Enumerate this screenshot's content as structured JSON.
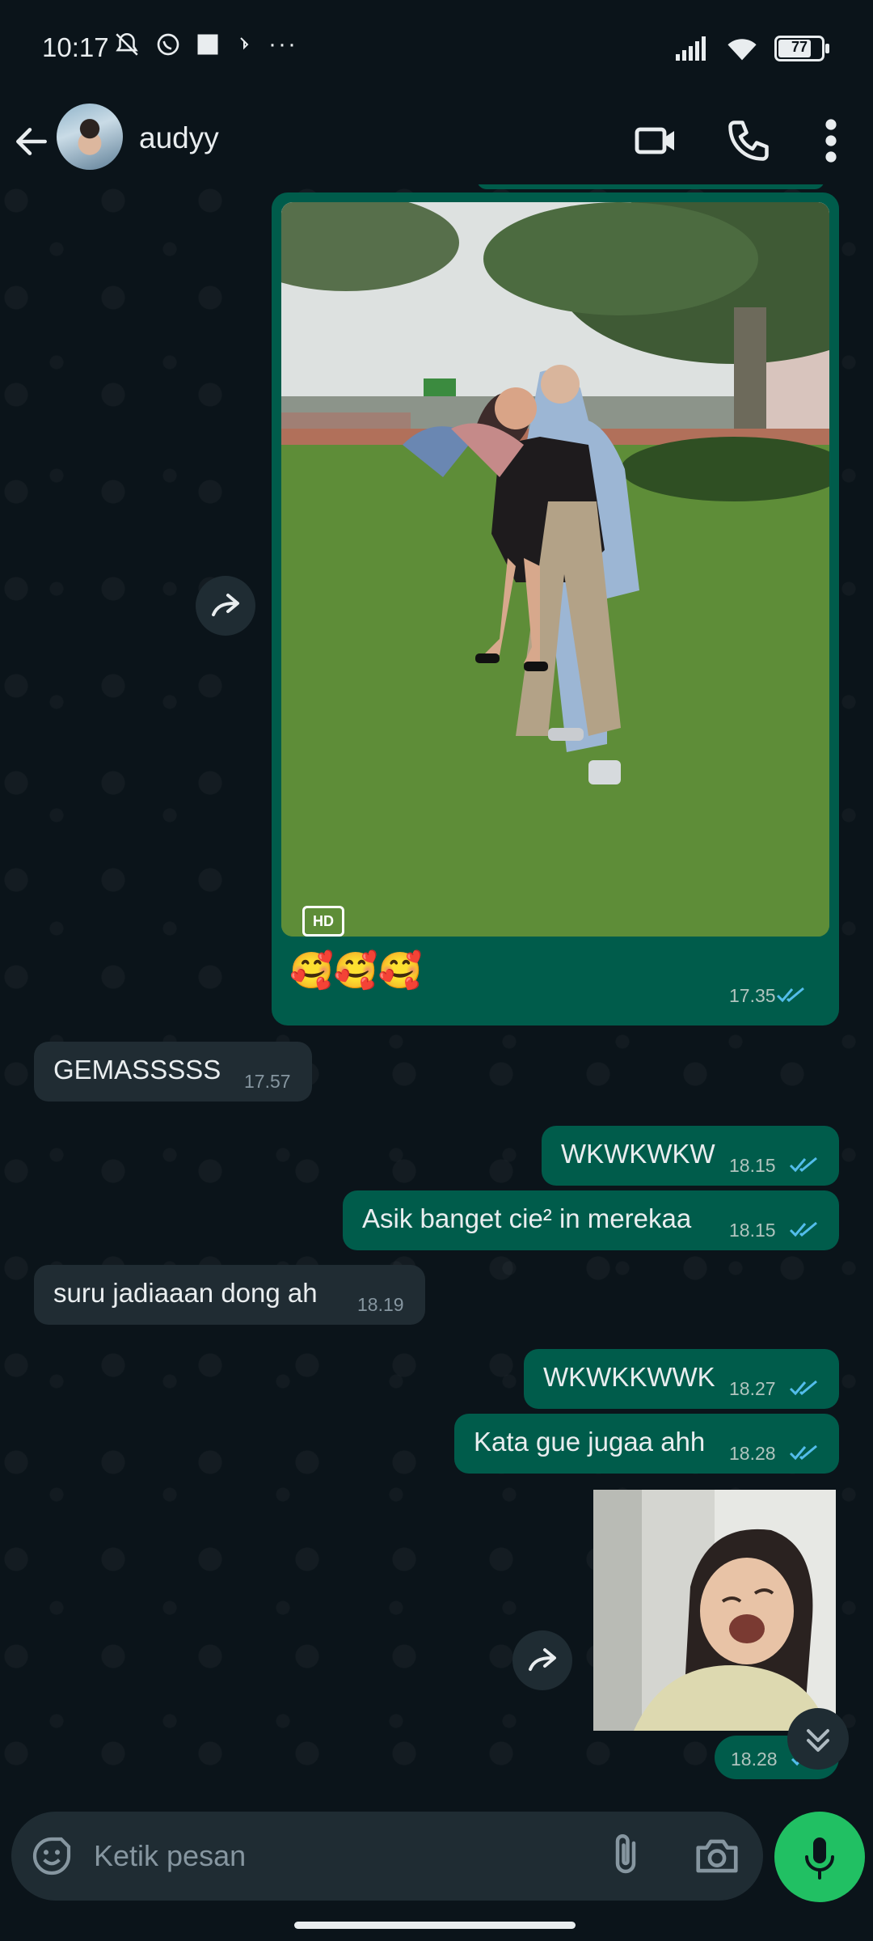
{
  "status_bar": {
    "time": "10:17",
    "battery": "77"
  },
  "header": {
    "contact_name": "audyy"
  },
  "messages": [
    {
      "id": "m1",
      "direction": "out",
      "type": "image",
      "caption": "🥰🥰🥰",
      "time": "17.35",
      "badge": "HD",
      "read": true
    },
    {
      "id": "m2",
      "direction": "in",
      "type": "text",
      "text": "GEMASSSSS",
      "time": "17.57"
    },
    {
      "id": "m3",
      "direction": "out",
      "type": "text",
      "text": "WKWKWKW",
      "time": "18.15",
      "read": true
    },
    {
      "id": "m4",
      "direction": "out",
      "type": "text",
      "text": "Asik banget cie² in merekaa",
      "time": "18.15",
      "read": true
    },
    {
      "id": "m5",
      "direction": "in",
      "type": "text",
      "text": "suru jadiaaan dong ah",
      "time": "18.19"
    },
    {
      "id": "m6",
      "direction": "out",
      "type": "text",
      "text": "WKWKKWWK",
      "time": "18.27",
      "read": true
    },
    {
      "id": "m7",
      "direction": "out",
      "type": "text",
      "text": "Kata gue jugaa ahh",
      "time": "18.28",
      "read": true
    },
    {
      "id": "m8",
      "direction": "out",
      "type": "sticker",
      "time": "18.28",
      "read": true
    }
  ],
  "composer": {
    "placeholder": "Ketik pesan"
  },
  "colors": {
    "background": "#0b141a",
    "outgoing_bubble": "#005c4b",
    "incoming_bubble": "#202c33",
    "read_ticks": "#53bdeb",
    "mic_button": "#21c063"
  },
  "icons": [
    "back-arrow-icon",
    "video-call-icon",
    "voice-call-icon",
    "more-options-icon",
    "forward-icon",
    "double-check-icon",
    "scroll-down-icon",
    "emoji-icon",
    "attach-icon",
    "camera-icon",
    "mic-icon"
  ]
}
